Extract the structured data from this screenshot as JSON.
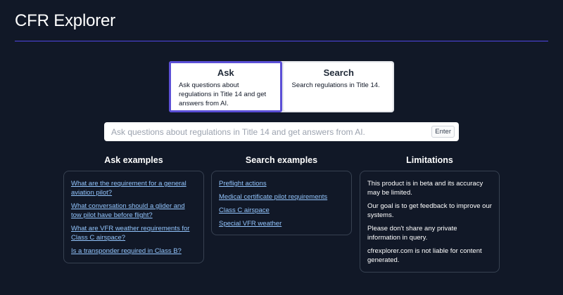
{
  "app": {
    "title": "CFR Explorer"
  },
  "modes": [
    {
      "title": "Ask",
      "description": "Ask questions about regulations in Title 14 and get answers from AI.",
      "active": true
    },
    {
      "title": "Search",
      "description": "Search regulations in Title 14.",
      "active": false
    }
  ],
  "search": {
    "placeholder": "Ask questions about regulations in Title 14 and get answers from AI.",
    "value": "",
    "enter_label": "Enter"
  },
  "ask_examples": {
    "heading": "Ask examples",
    "items": [
      "What are the requirement for a general aviation pilot?",
      "What conversation should a glider and tow pilot have before flight?",
      "What are VFR weather requirements for Class C airspace?",
      "Is a transponder required in Class B?"
    ]
  },
  "search_examples": {
    "heading": "Search examples",
    "items": [
      "Preflight actions",
      "Medical certificate pilot requirements",
      "Class C airspace",
      "Special VFR weather"
    ]
  },
  "limitations": {
    "heading": "Limitations",
    "items": [
      "This product is in beta and its accuracy may be limited.",
      "Our goal is to get feedback to improve our systems.",
      "Please don't share any private information in query.",
      "cfrexplorer.com is not liable for content generated."
    ]
  },
  "colors": {
    "background": "#111827",
    "accent": "#4f46e5",
    "active_border": "#5b4fd6",
    "link": "#93c5fd",
    "panel_border": "#374151"
  }
}
